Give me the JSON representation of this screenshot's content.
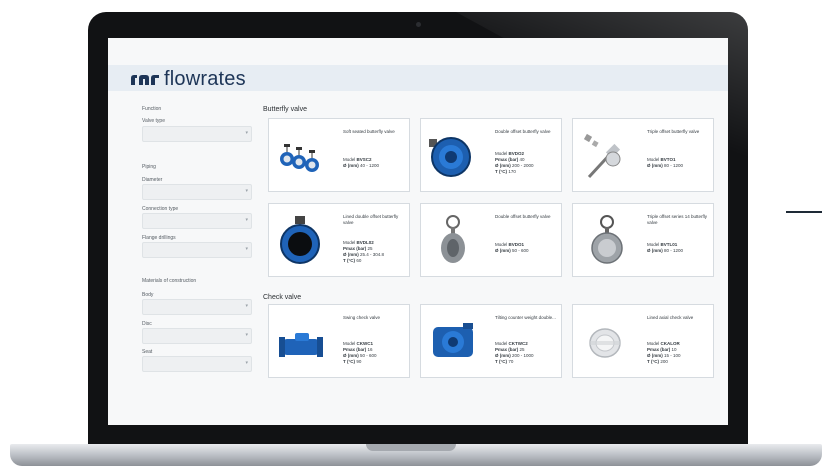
{
  "app": {
    "logo_text": "flowrates"
  },
  "sidebar": {
    "function_label": "Function",
    "valve_type_label": "Valve type",
    "piping_label": "Piping",
    "diameter_label": "Diameter",
    "connection_type_label": "Connection type",
    "flange_label": "Flange drillings",
    "materials_label": "Materials of construction",
    "body_label": "Body",
    "disc_label": "Disc",
    "seat_label": "Seat"
  },
  "sections": {
    "butterfly_title": "Butterfly valve",
    "check_title": "Check valve"
  },
  "products": [
    {
      "name": "Soft seated butterfly valve",
      "model_label": "Model",
      "model": "BVSC2",
      "dia_label": "Ø (mm)",
      "dia": "40 - 1200"
    },
    {
      "name": "Double offset butterfly valve",
      "model_label": "Model",
      "model": "BVDO2",
      "pmax_label": "Pmax (bar)",
      "pmax": "40",
      "dia_label": "Ø (mm)",
      "dia": "200 - 2000",
      "temp_label": "T (°C)",
      "temp": "170"
    },
    {
      "name": "Triple offset butterfly valve",
      "model_label": "Model",
      "model": "BVTO1",
      "dia_label": "Ø (mm)",
      "dia": "80 - 1200"
    },
    {
      "name": "Lined double offset butterfly valve",
      "model_label": "Model",
      "model": "BVDL02",
      "pmax_label": "Pmax (bar)",
      "pmax": "25",
      "dia_label": "Ø (mm)",
      "dia": "25.4 - 304.8",
      "temp_label": "T (°C)",
      "temp": "60"
    },
    {
      "name": "Double offset butterfly valve",
      "model_label": "Model",
      "model": "BVDO1",
      "dia_label": "Ø (mm)",
      "dia": "50 - 600"
    },
    {
      "name": "Triple offset series 14 butterfly valve",
      "model_label": "Model",
      "model": "BVTL01",
      "dia_label": "Ø (mm)",
      "dia": "80 - 1200"
    },
    {
      "name": "Swing check valve",
      "model_label": "Model",
      "model": "CKWC1",
      "pmax_label": "Pmax (bar)",
      "pmax": "16",
      "dia_label": "Ø (mm)",
      "dia": "50 - 600",
      "temp_label": "T (°C)",
      "temp": "90"
    },
    {
      "name": "Tilting counter weight double...",
      "model_label": "Model",
      "model": "CKTWC2",
      "pmax_label": "Pmax (bar)",
      "pmax": "25",
      "dia_label": "Ø (mm)",
      "dia": "200 - 1000",
      "temp_label": "T (°C)",
      "temp": "70"
    },
    {
      "name": "Lined axial check valve",
      "model_label": "Model",
      "model": "CKALOR",
      "pmax_label": "Pmax (bar)",
      "pmax": "10",
      "dia_label": "Ø (mm)",
      "dia": "15 - 100",
      "temp_label": "T (°C)",
      "temp": "200"
    }
  ],
  "colors": {
    "accent": "#1d3557",
    "header_bg": "#e7edf3",
    "valve_blue": "#1f63b8"
  }
}
